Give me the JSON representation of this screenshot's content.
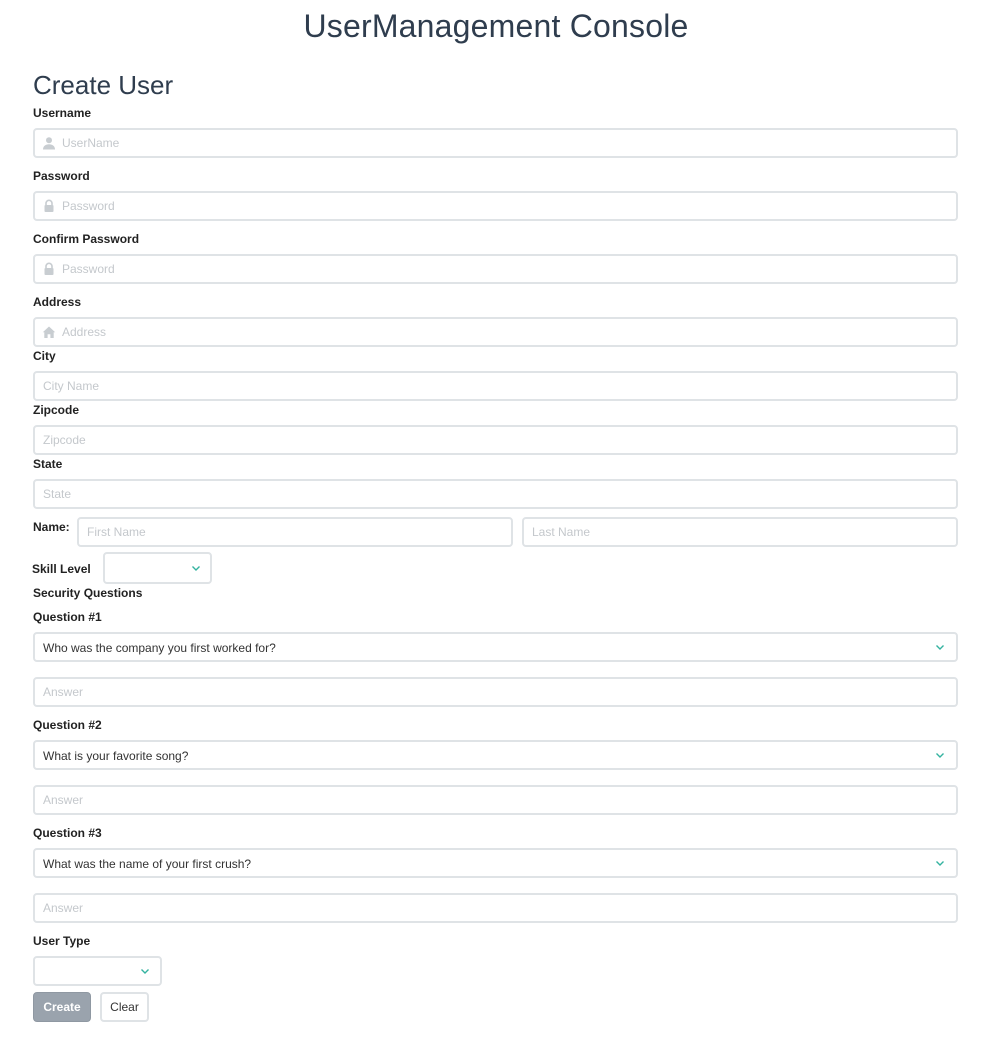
{
  "app": {
    "title": "UserManagement Console"
  },
  "form": {
    "title": "Create User",
    "username": {
      "label": "Username",
      "placeholder": "UserName",
      "value": ""
    },
    "password": {
      "label": "Password",
      "placeholder": "Password",
      "value": ""
    },
    "confirm_password": {
      "label": "Confirm Password",
      "placeholder": "Password",
      "value": ""
    },
    "address": {
      "label": "Address",
      "placeholder": "Address",
      "value": ""
    },
    "city": {
      "label": "City",
      "placeholder": "City Name",
      "value": ""
    },
    "zipcode": {
      "label": "Zipcode",
      "placeholder": "Zipcode",
      "value": ""
    },
    "state": {
      "label": "State",
      "placeholder": "State",
      "value": ""
    },
    "name": {
      "label": "Name:",
      "first_placeholder": "First Name",
      "last_placeholder": "Last Name",
      "first_value": "",
      "last_value": ""
    },
    "skill_level": {
      "label": "Skill Level",
      "selected": ""
    },
    "security": {
      "label": "Security Questions",
      "questions": [
        {
          "label": "Question #1",
          "selected": "Who was the company you first worked for?",
          "answer_placeholder": "Answer",
          "answer_value": ""
        },
        {
          "label": "Question #2",
          "selected": "What is your favorite song?",
          "answer_placeholder": "Answer",
          "answer_value": ""
        },
        {
          "label": "Question #3",
          "selected": "What was the name of your first crush?",
          "answer_placeholder": "Answer",
          "answer_value": ""
        }
      ]
    },
    "user_type": {
      "label": "User Type",
      "selected": ""
    },
    "buttons": {
      "create": "Create",
      "clear": "Clear"
    }
  },
  "icons": {
    "username": "user-icon",
    "password": "lock-icon",
    "confirm_password": "lock-icon",
    "address": "home-icon",
    "dropdown": "chevron-down-icon"
  },
  "colors": {
    "title": "#2f3d4e",
    "accent_chevron": "#34b3a0",
    "create_button": "#9aa3ad",
    "input_border": "#dfe3e6",
    "placeholder": "#c4c8cc"
  }
}
